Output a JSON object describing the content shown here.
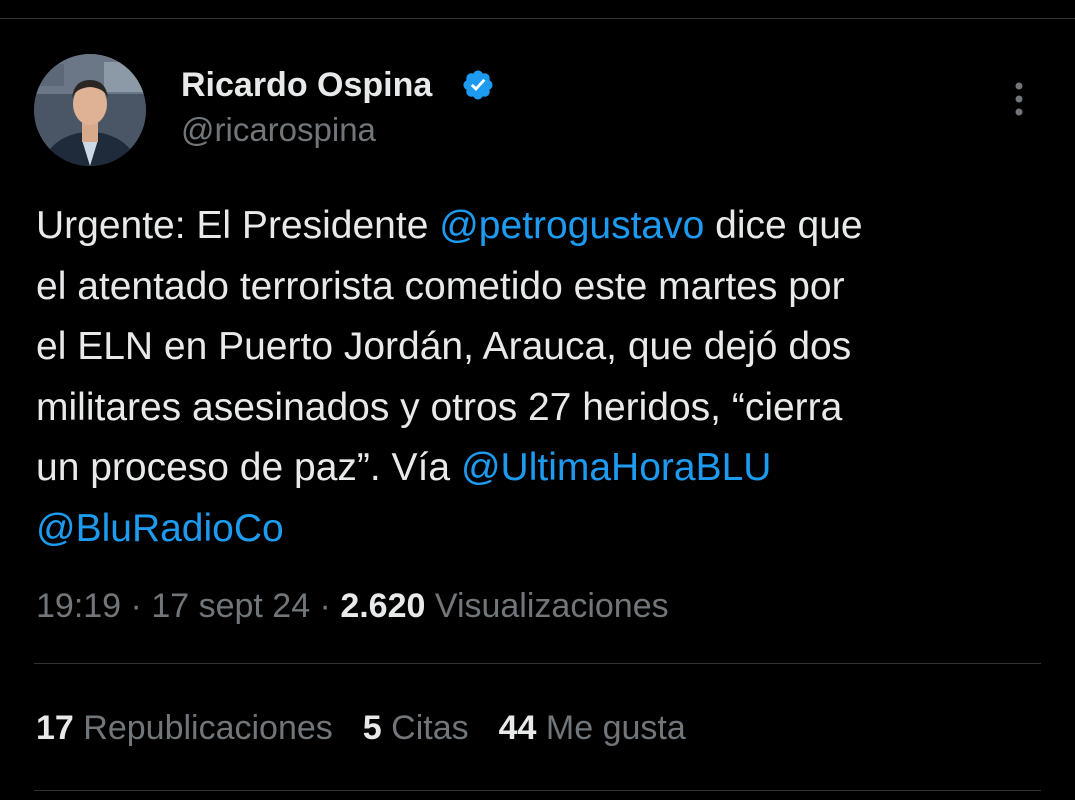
{
  "author": {
    "display_name": "Ricardo Ospina",
    "handle": "@ricarospina",
    "verified_color": "#1d9bf0"
  },
  "tweet": {
    "lines": [
      [
        {
          "t": "Urgente: El Presidente "
        },
        {
          "t": "@petrogustavo",
          "m": true
        },
        {
          "t": " dice que"
        }
      ],
      [
        {
          "t": "el atentado terrorista cometido este martes por"
        }
      ],
      [
        {
          "t": "el ELN en Puerto Jordán, Arauca, que dejó dos"
        }
      ],
      [
        {
          "t": "militares asesinados y otros 27 heridos, “cierra"
        }
      ],
      [
        {
          "t": "un proceso de paz”. Vía "
        },
        {
          "t": "@UltimaHoraBLU",
          "m": true
        }
      ],
      [
        {
          "t": "@BluRadioCo",
          "m": true
        }
      ]
    ]
  },
  "meta": {
    "time": "19:19",
    "separator1": " · ",
    "date": "17 sept 24",
    "separator2": " · ",
    "views_count": "2.620",
    "views_label": "Visualizaciones"
  },
  "stats": {
    "reposts_count": "17",
    "reposts_label": "Republicaciones",
    "quotes_count": "5",
    "quotes_label": "Citas",
    "likes_count": "44",
    "likes_label": "Me gusta"
  },
  "colors": {
    "background": "#000000",
    "text": "#e7e9ea",
    "muted": "#71767b",
    "link": "#1d9bf0",
    "divider": "#2f3336"
  }
}
